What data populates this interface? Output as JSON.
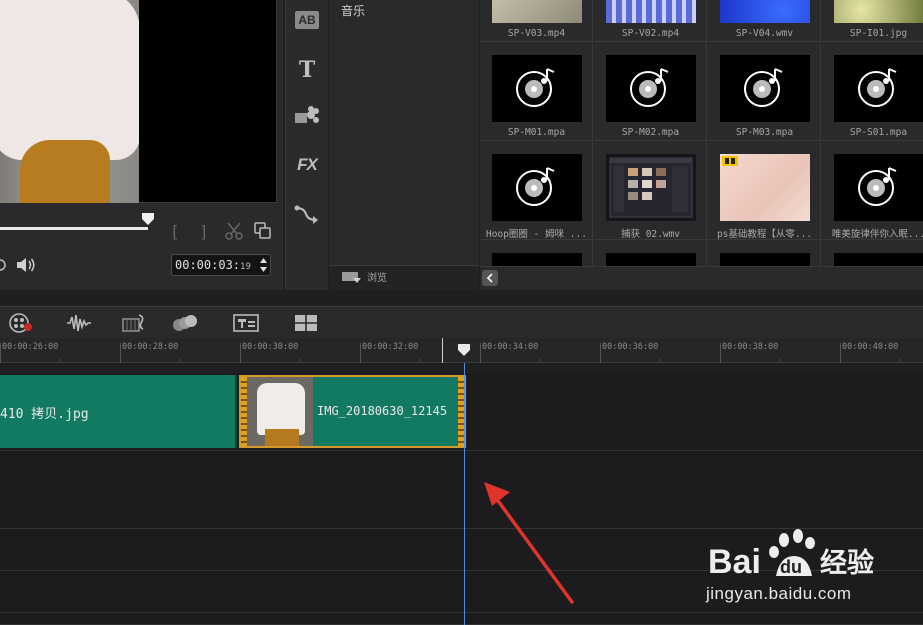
{
  "preview": {
    "timecode_main": "00:00:03:",
    "timecode_frames": "19",
    "mark_in": "[",
    "mark_out": "]"
  },
  "side_toolbar": {
    "items": [
      {
        "label": "AB",
        "icon": "transition-icon"
      },
      {
        "label": "T",
        "icon": "title-icon"
      },
      {
        "label": "",
        "icon": "graphic-icon"
      },
      {
        "label": "FX",
        "icon": "filter-icon"
      },
      {
        "label": "",
        "icon": "path-icon"
      }
    ]
  },
  "library_nav": {
    "item": "音乐",
    "browse_label": "浏览"
  },
  "media_grid": {
    "items": [
      {
        "label": "SP-V03.mp4",
        "thumb": "video-beige"
      },
      {
        "label": "SP-V02.mp4",
        "thumb": "video-blue-pattern"
      },
      {
        "label": "SP-V04.wmv",
        "thumb": "video-blue"
      },
      {
        "label": "SP-I01.jpg",
        "thumb": "image-green"
      },
      {
        "label": "SP-M01.mpa",
        "thumb": "audio"
      },
      {
        "label": "SP-M02.mpa",
        "thumb": "audio"
      },
      {
        "label": "SP-M03.mpa",
        "thumb": "audio"
      },
      {
        "label": "SP-S01.mpa",
        "thumb": "audio"
      },
      {
        "label": "Hoop圈圈 - 姆咪 ...",
        "thumb": "audio"
      },
      {
        "label": "捕获 02.wmv",
        "thumb": "screen-capture"
      },
      {
        "label": "ps基础教程【从零...",
        "thumb": "video-pink"
      },
      {
        "label": "唯美旋律伴你入眠...",
        "thumb": "audio"
      }
    ]
  },
  "timeline": {
    "ruler": [
      "00:00:26:00",
      "00:00:28:00",
      "00:00:30:00",
      "00:00:32:00",
      "00:00:34:00",
      "00:00:36:00",
      "00:00:38:00",
      "00:00:40:00"
    ],
    "clips": [
      {
        "label": "410 拷贝.jpg"
      },
      {
        "label": "IMG_20180630_12145"
      }
    ]
  },
  "watermark": {
    "brand": "Bai",
    "brand2": "du",
    "suffix": "经验",
    "url": "jingyan.baidu.com"
  },
  "colors": {
    "clip_green": "#127a62",
    "clip_border_selected": "#d59a2b",
    "playhead": "#4a90d9",
    "annotation_arrow": "#e0332c"
  }
}
